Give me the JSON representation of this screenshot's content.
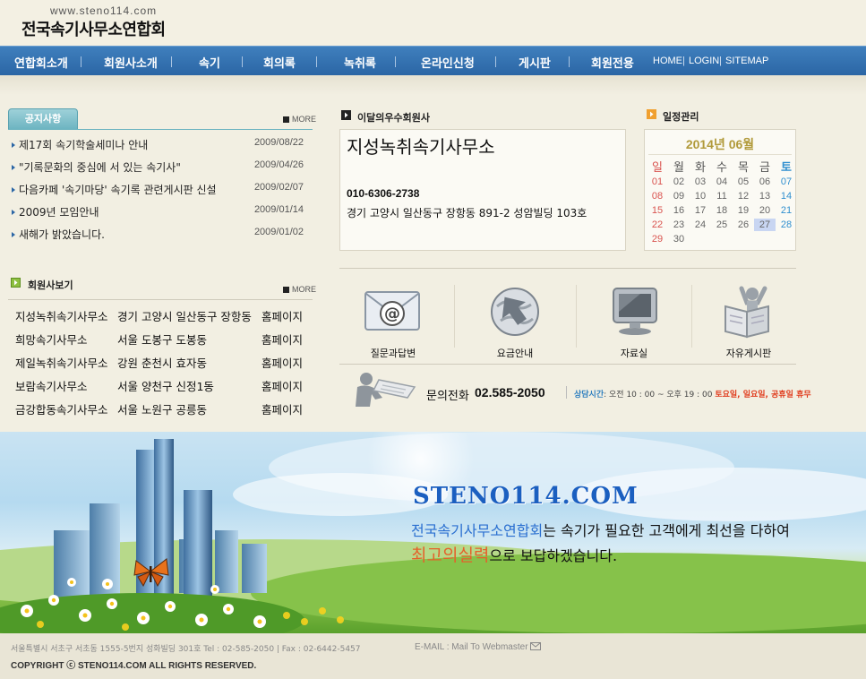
{
  "header": {
    "url": "www.steno114.com",
    "title": "전국속기사무소연합회"
  },
  "nav": {
    "items": [
      "연합회소개",
      "회원사소개",
      "속기",
      "회의록",
      "녹취록",
      "온라인신청",
      "게시판",
      "회원전용"
    ],
    "utility": [
      "HOME",
      "LOGIN",
      "SITEMAP"
    ],
    "utility_separator": "|"
  },
  "notice": {
    "tab": "공지사항",
    "more": "MORE",
    "items": [
      {
        "title": "제17회 속기학술세미나 안내",
        "date": "2009/08/22"
      },
      {
        "title": "\"기록문화의 중심에 서 있는 속기사\"",
        "date": "2009/04/26"
      },
      {
        "title": "다음카페 '속기마당' 속기록 관련게시판 신설",
        "date": "2009/02/07"
      },
      {
        "title": "2009년 모임안내",
        "date": "2009/01/14"
      },
      {
        "title": "새해가 밝았습니다.",
        "date": "2009/01/02"
      }
    ]
  },
  "members": {
    "title": "회원사보기",
    "more": "MORE",
    "rows": [
      {
        "name": "지성녹취속기사무소",
        "address": "경기 고양시 일산동구 장항동",
        "link": "홈페이지"
      },
      {
        "name": "희망속기사무소",
        "address": "서울 도봉구 도봉동",
        "link": "홈페이지"
      },
      {
        "name": "제일녹취속기사무소",
        "address": "강원 춘천시 효자동",
        "link": "홈페이지"
      },
      {
        "name": "보람속기사무소",
        "address": "서울 양천구 신정1동",
        "link": "홈페이지"
      },
      {
        "name": "금강합동속기사무소",
        "address": "서울 노원구 공릉동",
        "link": "홈페이지"
      }
    ]
  },
  "featured": {
    "title": "이달의우수회원사",
    "name": "지성녹취속기사무소",
    "phone": "010-6306-2738",
    "address": "경기 고양시 일산동구 장항동 891-2 성암빌딩 103호"
  },
  "calendar": {
    "title": "일정관리",
    "month_label": "2014년 06월",
    "weekdays": [
      "일",
      "월",
      "화",
      "수",
      "목",
      "금",
      "토"
    ],
    "weeks": [
      [
        "01",
        "02",
        "03",
        "04",
        "05",
        "06",
        "07"
      ],
      [
        "08",
        "09",
        "10",
        "11",
        "12",
        "13",
        "14"
      ],
      [
        "15",
        "16",
        "17",
        "18",
        "19",
        "20",
        "21"
      ],
      [
        "22",
        "23",
        "24",
        "25",
        "26",
        "27",
        "28"
      ],
      [
        "29",
        "30",
        "",
        "",
        "",
        "",
        ""
      ]
    ],
    "highlight": "27"
  },
  "quick_links": [
    {
      "label": "질문과답변",
      "icon": "envelope-at-icon"
    },
    {
      "label": "요금안내",
      "icon": "globe-arrow-icon"
    },
    {
      "label": "자료실",
      "icon": "monitor-icon"
    },
    {
      "label": "자유게시판",
      "icon": "person-reading-icon"
    }
  ],
  "contact": {
    "label": "문의전화",
    "phone": "02.585-2050",
    "hours_label": "상담시간",
    "hours_text": ": 오전 10 : 00 ~ 오후 19 : 00",
    "closed_text": "토요일, 일요일, 공휴일 휴무"
  },
  "banner": {
    "domain": "STENO114.COM",
    "line1_highlight": "전국속기사무소연합회",
    "line1_rest": "는 속기가 필요한 고객에게 최선을 다하여",
    "line2_highlight": "최고의실력",
    "line2_rest": "으로 보답하겠습니다."
  },
  "footer": {
    "address": "서울특별시 서초구 서초동 1555-5번지 성화빌딩 301호    Tel : 02-585-2050  |  Fax : 02-6442-5457",
    "email_label": "E-MAIL : Mail To Webmaster",
    "copyright": "COPYRIGHT ⓒ STENO114.COM  ALL RIGHTS RESERVED."
  },
  "colors": {
    "nav_blue": "#2b66a5",
    "accent_teal": "#6bb3c0",
    "banner_blue": "#1b5fc0",
    "banner_orange": "#e4622b",
    "calendar_gold": "#b19a3a"
  }
}
